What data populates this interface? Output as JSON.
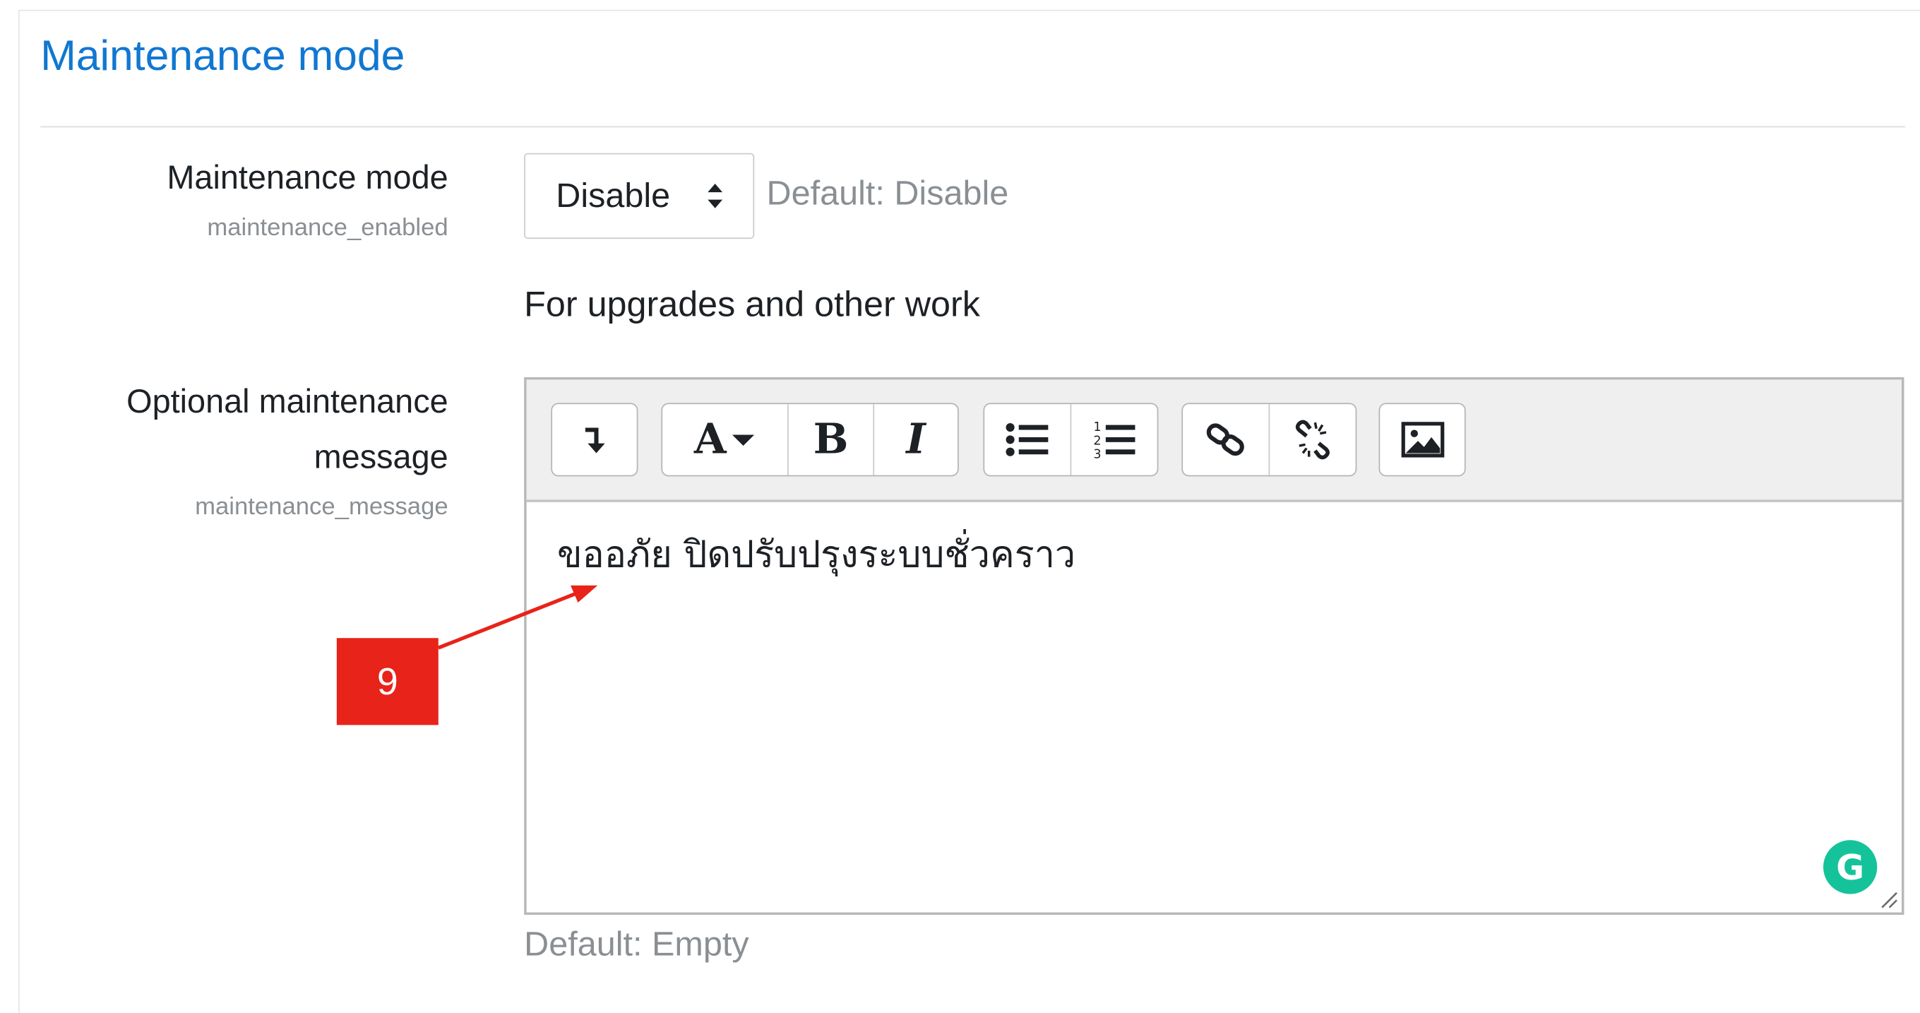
{
  "section": {
    "title": "Maintenance mode"
  },
  "setting_mode": {
    "label": "Maintenance mode",
    "key": "maintenance_enabled",
    "value": "Disable",
    "default": "Default: Disable",
    "description": "For upgrades and other work"
  },
  "setting_message": {
    "label_line1": "Optional maintenance",
    "label_line2": "message",
    "key": "maintenance_message",
    "content": "ขออภัย ปิดปรับปรุงระบบชั่วคราว",
    "default": "Default: Empty"
  },
  "toolbar": {
    "groups": [
      [
        "expand-toolbar-icon"
      ],
      [
        "font-color-icon",
        "bold-icon",
        "italic-icon"
      ],
      [
        "unordered-list-icon",
        "ordered-list-icon"
      ],
      [
        "link-icon",
        "unlink-icon"
      ],
      [
        "image-icon"
      ]
    ],
    "font_color_glyph": "A",
    "bold_glyph": "B",
    "italic_glyph": "I"
  },
  "grammarly": {
    "glyph": "G",
    "color": "#15c39a"
  },
  "annotation": {
    "number": "9",
    "color": "#e8231a"
  },
  "colors": {
    "title": "#1177d1",
    "hint": "#8a8f94",
    "toolbar_bg": "#efefef"
  }
}
